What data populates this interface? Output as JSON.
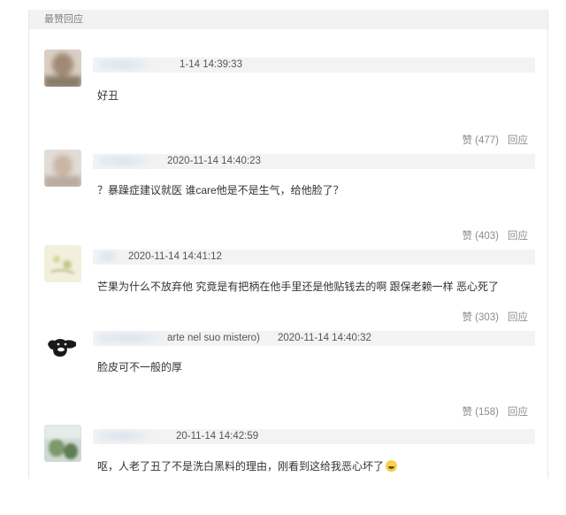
{
  "section": {
    "title": "最赞回应"
  },
  "comments": [
    {
      "meta_suffix": "1-14 14:39:33",
      "text": "好丑",
      "like_label": "赞 (477)",
      "reply_label": "回应"
    },
    {
      "meta_suffix": "2020-11-14 14:40:23",
      "text": "？暴躁症建议就医 谁care他是不是生气，给他脸了？",
      "like_label": "赞 (403)",
      "reply_label": "回应"
    },
    {
      "meta_suffix": "2020-11-14 14:41:12",
      "text": "芒果为什么不放弃他 究竟是有把柄在他手里还是他贴钱去的啊 跟保老赖一样 恶心死了",
      "like_label": "赞 (303)",
      "reply_label": "回应"
    },
    {
      "meta_name_tail": "arte nel suo mistero)",
      "meta_suffix": "2020-11-14 14:40:32",
      "text": "脸皮可不一般的厚",
      "like_label": "赞 (158)",
      "reply_label": "回应"
    },
    {
      "meta_suffix": "20-11-14 14:42:59",
      "text": "呕，人老了丑了不是洗白黑料的理由，刚看到这给我恶心坏了",
      "emoji_icon": "crying-face-emoji"
    }
  ]
}
